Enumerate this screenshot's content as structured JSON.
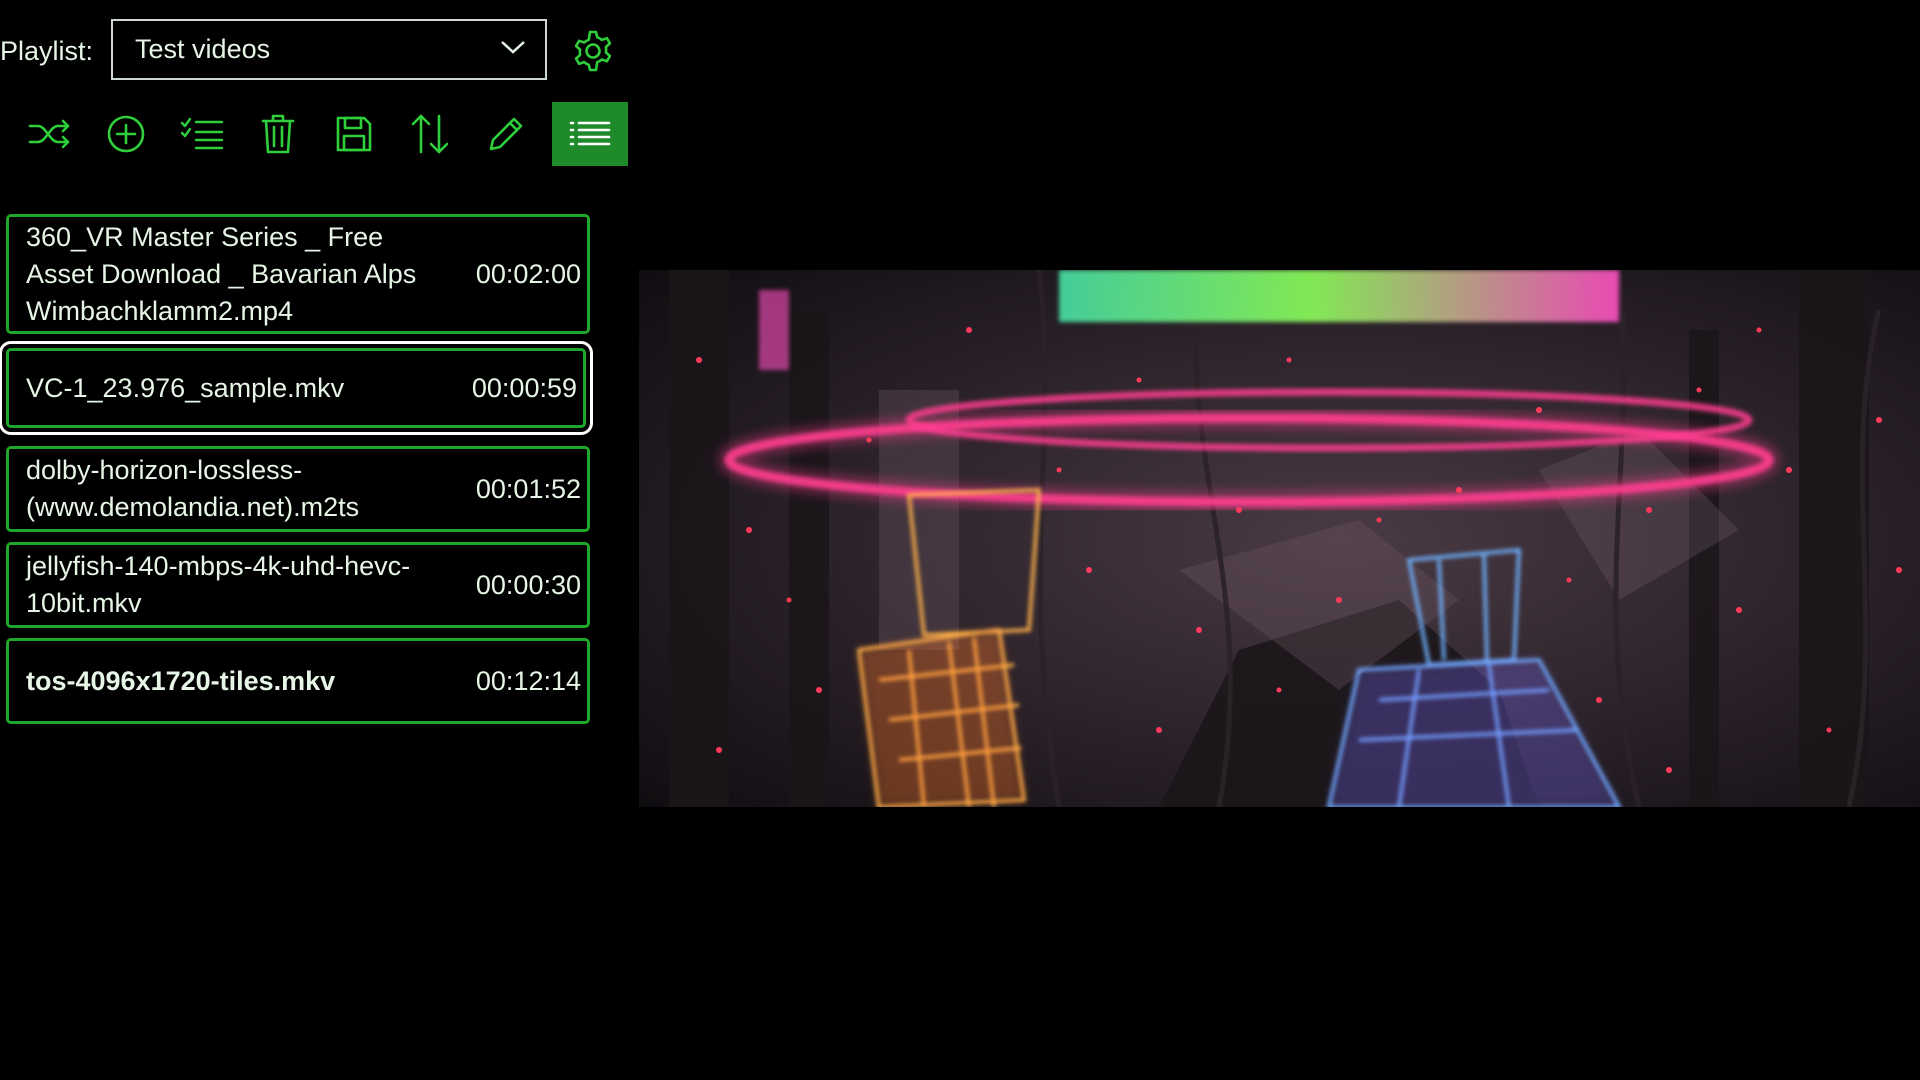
{
  "playlist": {
    "label": "Playlist:",
    "selected": "Test videos"
  },
  "toolbar": {
    "buttons": [
      {
        "name": "shuffle-icon"
      },
      {
        "name": "add-icon"
      },
      {
        "name": "select-list-icon"
      },
      {
        "name": "delete-icon"
      },
      {
        "name": "save-icon"
      },
      {
        "name": "sort-icon"
      },
      {
        "name": "edit-icon"
      },
      {
        "name": "list-view-icon",
        "active": true
      }
    ]
  },
  "items": [
    {
      "title": "360_VR Master Series _ Free Asset Download _ Bavarian Alps Wimbachklamm2.mp4",
      "duration": "00:02:00"
    },
    {
      "title": "VC-1_23.976_sample.mkv",
      "duration": "00:00:59"
    },
    {
      "title": "dolby-horizon-lossless-(www.demolandia.net).m2ts",
      "duration": "00:01:52"
    },
    {
      "title": "jellyfish-140-mbps-4k-uhd-hevc-10bit.mkv",
      "duration": "00:00:30"
    },
    {
      "title": "tos-4096x1720-tiles.mkv",
      "duration": "00:12:14"
    }
  ],
  "colors": {
    "accent": "#1ea82b",
    "active_button": "#1f8a2a",
    "background": "#000000",
    "text": "#e6f5e6",
    "focus": "#ffffff"
  }
}
